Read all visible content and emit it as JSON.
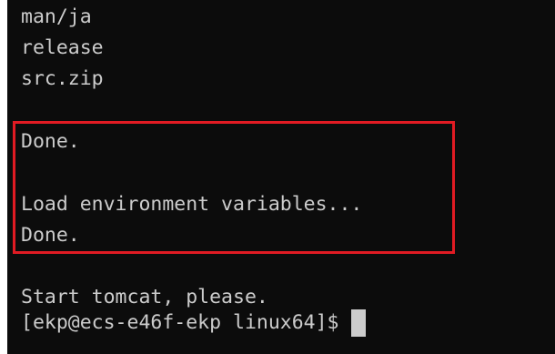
{
  "terminal": {
    "lines": [
      "man/ja",
      "release",
      "src.zip",
      "",
      "Done.",
      "",
      "Load environment variables...",
      "Done.",
      "",
      "Start tomcat, please."
    ],
    "prompt": "[ekp@ecs-e46f-ekp linux64]$ ",
    "colors": {
      "background": "#0c0c0c",
      "foreground": "#cccccc",
      "highlight_border": "#e11b23"
    }
  }
}
